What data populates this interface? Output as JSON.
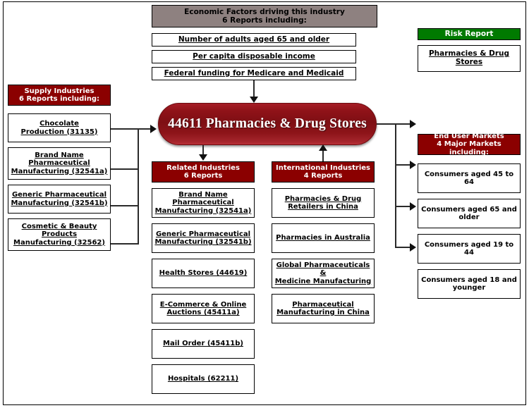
{
  "diagram": {
    "center": {
      "label": "44611 Pharmacies & Drug Stores"
    },
    "economic_factors": {
      "header_line1": "Economic Factors driving this industry",
      "header_line2": "6 Reports including:",
      "items": [
        {
          "label": "Number of adults aged 65 and older"
        },
        {
          "label": "Per capita disposable income"
        },
        {
          "label": "Federal funding for Medicare and Medicaid"
        }
      ]
    },
    "risk_report": {
      "header": "Risk Report",
      "items": [
        {
          "label": "Pharmacies & Drug Stores"
        }
      ]
    },
    "supply_industries": {
      "header_line1": "Supply Industries",
      "header_line2": "6 Reports including:",
      "items": [
        {
          "line1": "Chocolate",
          "line2": "Production (31135)"
        },
        {
          "line1": "Brand Name",
          "line2": "Pharmaceutical",
          "line3": "Manufacturing (32541a)"
        },
        {
          "line1": "Generic Pharmaceutical",
          "line2": "Manufacturing (32541b)"
        },
        {
          "line1": "Cosmetic & Beauty",
          "line2": "Products",
          "line3": "Manufacturing (32562)"
        }
      ]
    },
    "related_industries": {
      "header_line1": "Related Industries",
      "header_line2": "6 Reports",
      "items": [
        {
          "line1": "Brand Name",
          "line2": "Pharmaceutical",
          "line3": "Manufacturing (32541a)"
        },
        {
          "line1": "Generic Pharmaceutical",
          "line2": "Manufacturing (32541b)"
        },
        {
          "line1": "Health Stores (44619)"
        },
        {
          "line1": "E-Commerce & Online",
          "line2": "Auctions (45411a)"
        },
        {
          "line1": "Mail Order (45411b)"
        },
        {
          "line1": "Hospitals (62211)"
        }
      ]
    },
    "international_industries": {
      "header_line1": "International Industries",
      "header_line2": "4 Reports",
      "items": [
        {
          "line1": "Pharmacies & Drug",
          "line2": "Retailers in China"
        },
        {
          "line1": "Pharmacies in Australia"
        },
        {
          "line1": "Global Pharmaceuticals &",
          "line2": "Medicine Manufacturing"
        },
        {
          "line1": "Pharmaceutical",
          "line2": "Manufacturing in China"
        }
      ]
    },
    "end_user_markets": {
      "header_line1": "End User Markets",
      "header_line2": "4 Major Markets including:",
      "items": [
        {
          "line1": "Consumers aged 45 to 64"
        },
        {
          "line1": "Consumers aged 65 and",
          "line2": "older"
        },
        {
          "line1": "Consumers aged 19 to 44"
        },
        {
          "line1": "Consumers aged 18 and",
          "line2": "younger"
        }
      ]
    },
    "colors": {
      "maroon": "#8B0000",
      "green": "#007A00",
      "taupe": "#8E8180",
      "border": "#000000",
      "connector": "#2B2B2B"
    }
  }
}
